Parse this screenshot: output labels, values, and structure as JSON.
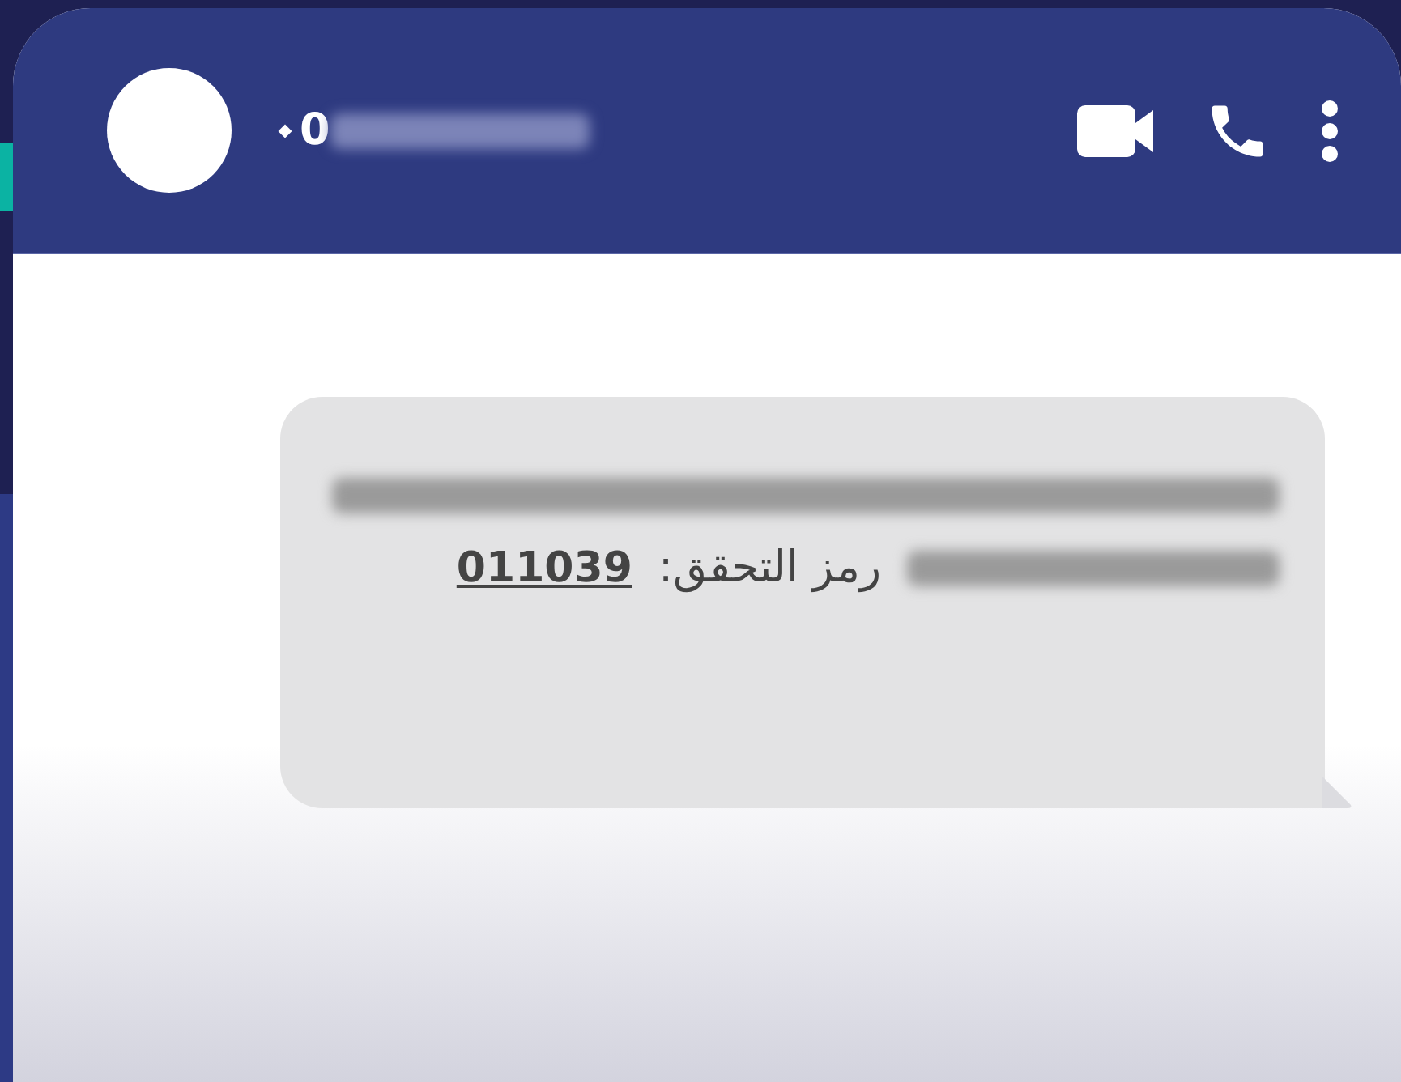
{
  "header": {
    "contact_number": "0"
  },
  "message": {
    "code_label": "رمز التحقق:",
    "code": "011039"
  }
}
